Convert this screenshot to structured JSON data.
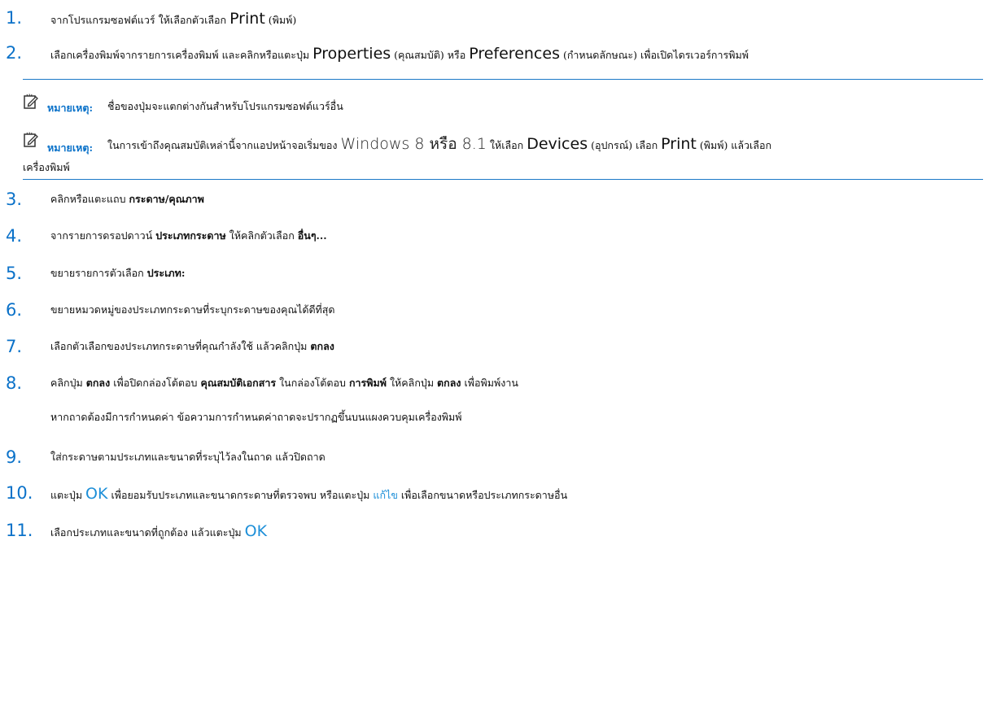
{
  "steps": {
    "s1": {
      "num": "1.",
      "a": "จากโปรแกรมซอฟต์แวร์ ให้เลือกตัวเลือก",
      "print": "Print",
      "b": "(พิมพ์)"
    },
    "s2": {
      "num": "2.",
      "a": "เลือกเครื่องพิมพ์จากรายการเครื่องพิมพ์ และคลิกหรือแตะปุ่ม",
      "properties": "Properties",
      "b": "(คุณสมบัติ) หรือ",
      "preferences": "Preferences",
      "c": "(กำหนดลักษณะ) เพื่อเปิดไดรเวอร์การพิมพ์"
    },
    "s3": {
      "num": "3.",
      "a": "คลิกหรือแตะแถบ",
      "tab": "กระดาษ/คุณภาพ"
    },
    "s4": {
      "num": "4.",
      "a": "จากรายการดรอปดาวน์",
      "list": "ประเภทกระดาษ",
      "b": "ให้คลิกตัวเลือก",
      "opt": "อื่นๆ..."
    },
    "s5": {
      "num": "5.",
      "a": "ขยายรายการตัวเลือก",
      "opt": "ประเภท:"
    },
    "s6": {
      "num": "6.",
      "a": "ขยายหมวดหมู่ของประเภทกระดาษที่ระบุกระดาษของคุณได้ดีที่สุด"
    },
    "s7": {
      "num": "7.",
      "a": "เลือกตัวเลือกของประเภทกระดาษที่คุณกำลังใช้ แล้วคลิกปุ่ม",
      "ok": "ตกลง"
    },
    "s8": {
      "num": "8.",
      "a": "คลิกปุ่ม",
      "ok1": "ตกลง",
      "b": "เพื่อปิดกล่องโต้ตอบ",
      "dlg1": "คุณสมบัติเอกสาร",
      "c": "ในกล่องโต้ตอบ",
      "dlg2": "การพิมพ์",
      "d": "ให้คลิกปุ่ม",
      "ok2": "ตกลง",
      "e": "เพื่อพิมพ์งาน",
      "sub": "หากถาดต้องมีการกำหนดค่า ข้อความการกำหนดค่าถาดจะปรากฏขึ้นบนแผงควบคุมเครื่องพิมพ์"
    },
    "s9": {
      "num": "9.",
      "a": "ใส่กระดาษตามประเภทและขนาดที่ระบุไว้ลงในถาด แล้วปิดถาด"
    },
    "s10": {
      "num": "10.",
      "a": "แตะปุ่ม",
      "ok": "OK",
      "b": "เพื่อยอมรับประเภทและขนาดกระดาษที่ตรวจพบ หรือแตะปุ่ม",
      "edit": "แก้ไข",
      "c": "เพื่อเลือกขนาดหรือประเภทกระดาษอื่น"
    },
    "s11": {
      "num": "11.",
      "a": "เลือกประเภทและขนาดที่ถูกต้อง แล้วแตะปุ่ม",
      "ok": "OK"
    }
  },
  "notes": {
    "n1": {
      "label": "หมายเหตุ:",
      "text": "ชื่อของปุ่มจะแตกต่างกันสำหรับโปรแกรมซอฟต์แวร์อื่น"
    },
    "n2": {
      "label": "หมายเหตุ:",
      "a": "ในการเข้าถึงคุณสมบัติเหล่านี้จากแอปหน้าจอเริ่มของ",
      "windows": "Windows 8 หรือ 8.1",
      "b": "ให้เลือก",
      "devices": "Devices",
      "c": "(อุปกรณ์) เลือก",
      "print": "Print",
      "d": "(พิมพ์) แล้วเลือก",
      "cont": "เครื่องพิมพ์"
    }
  },
  "colors": {
    "accent": "#0b72c9",
    "link": "#1d8fd8",
    "rule": "#1b79c7"
  },
  "icons": {
    "note": "note-pencil-icon"
  }
}
